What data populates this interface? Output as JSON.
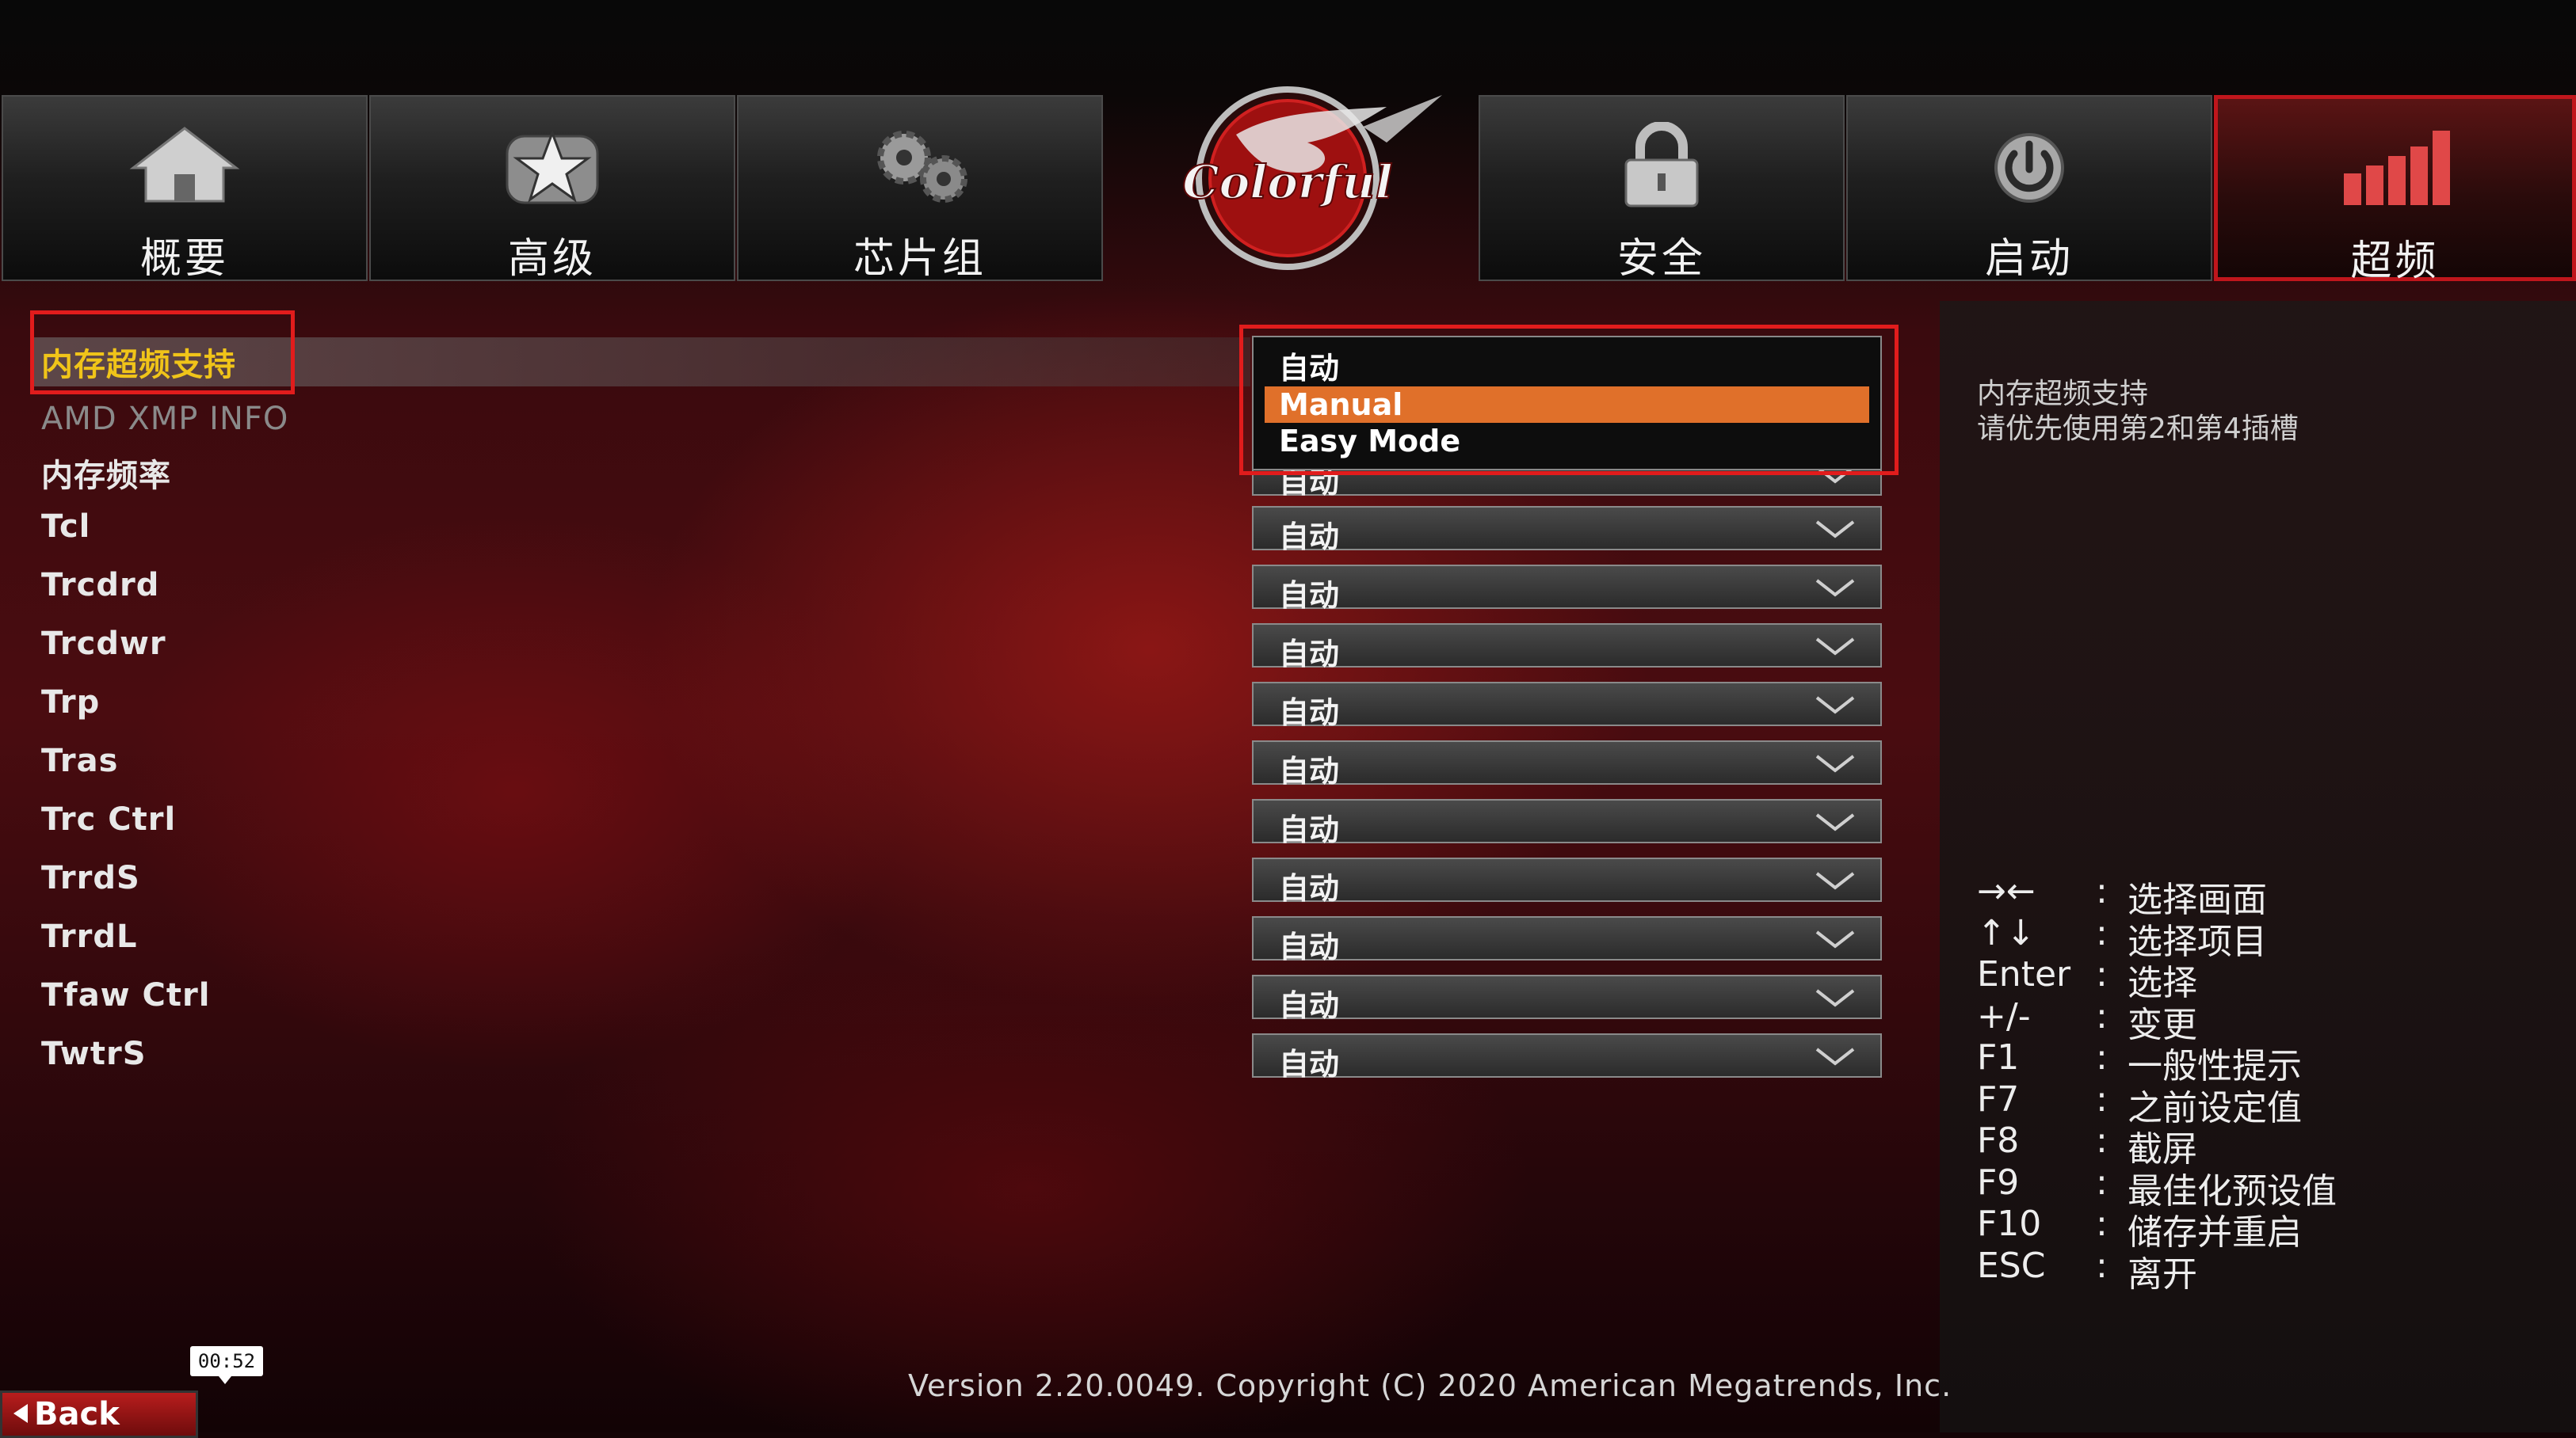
{
  "nav": {
    "tabs": [
      {
        "label": "概要",
        "icon": "home-icon"
      },
      {
        "label": "高级",
        "icon": "star-icon"
      },
      {
        "label": "芯片组",
        "icon": "gears-icon"
      },
      {
        "label": "安全",
        "icon": "lock-icon"
      },
      {
        "label": "启动",
        "icon": "power-icon"
      },
      {
        "label": "超频",
        "icon": "bar-chart-icon"
      }
    ],
    "active_tab": "超频",
    "logo_text": "Colorful"
  },
  "settings": {
    "items": [
      {
        "label": "内存超频支持",
        "value": "自动"
      },
      {
        "label": "AMD XMP INFO"
      },
      {
        "label": "内存频率",
        "value": "自动"
      },
      {
        "label": "Tcl",
        "value": "自动"
      },
      {
        "label": "Trcdrd",
        "value": "自动"
      },
      {
        "label": "Trcdwr",
        "value": "自动"
      },
      {
        "label": "Trp",
        "value": "自动"
      },
      {
        "label": "Tras",
        "value": "自动"
      },
      {
        "label": "Trc Ctrl",
        "value": "自动"
      },
      {
        "label": "TrrdS",
        "value": "自动"
      },
      {
        "label": "TrrdL",
        "value": "自动"
      },
      {
        "label": "Tfaw Ctrl",
        "value": "自动"
      },
      {
        "label": "TwtrS",
        "value": "自动"
      }
    ],
    "popup_options": [
      "自动",
      "Manual",
      "Easy Mode"
    ],
    "popup_selected": "Manual"
  },
  "help": {
    "line1": "内存超频支持",
    "line2": "请优先使用第2和第4插槽"
  },
  "keys": [
    {
      "key": "→←",
      "desc": "选择画面"
    },
    {
      "key": "↑↓",
      "desc": "选择项目"
    },
    {
      "key": "Enter",
      "desc": "选择"
    },
    {
      "key": "+/-",
      "desc": "变更"
    },
    {
      "key": "F1",
      "desc": "一般性提示"
    },
    {
      "key": "F7",
      "desc": "之前设定值"
    },
    {
      "key": "F8",
      "desc": "截屏"
    },
    {
      "key": "F9",
      "desc": "最佳化预设值"
    },
    {
      "key": "F10",
      "desc": "储存并重启"
    },
    {
      "key": "ESC",
      "desc": "离开"
    }
  ],
  "key_separator": ":",
  "footer": "Version 2.20.0049. Copyright (C) 2020 American Megatrends, Inc.",
  "back_label": "Back",
  "timestamp": "00:52",
  "colors": {
    "accent": "#c0161c",
    "highlight": "#f0c419",
    "selected_option": "#e0702a"
  }
}
